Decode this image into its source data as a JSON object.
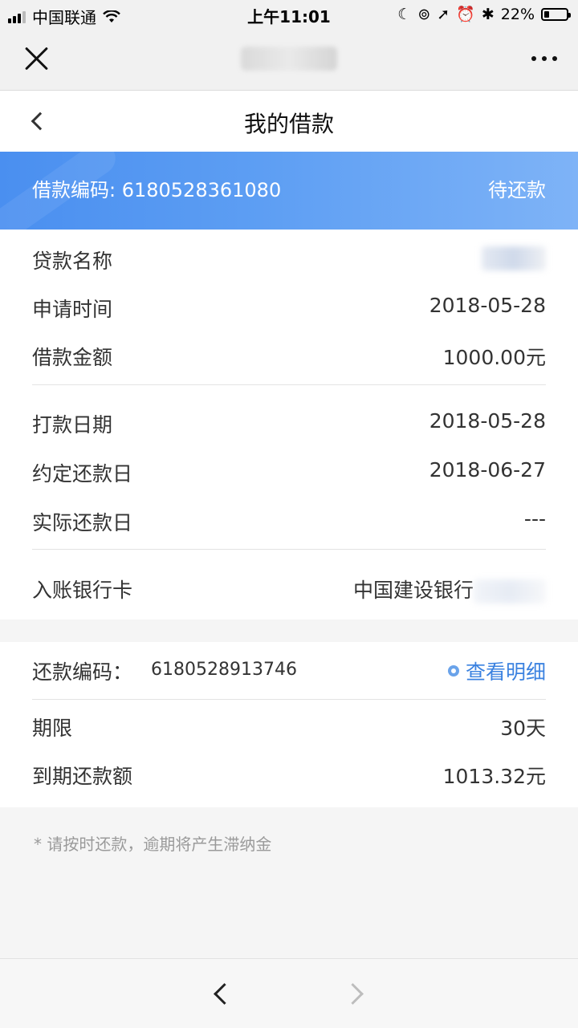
{
  "status_bar": {
    "carrier": "中国联通",
    "time": "上午11:01",
    "battery": "22%",
    "battery_level_fraction": 0.22
  },
  "browser": {
    "close_icon": "close-icon",
    "more_icon": "more-icon"
  },
  "header": {
    "title": "我的借款"
  },
  "banner": {
    "loan_code": "借款编码: 6180528361080",
    "status": "待还款"
  },
  "loan_details": {
    "loan_name_label": "贷款名称",
    "apply_time_label": "申请时间",
    "apply_time": "2018-05-28",
    "loan_amount_label": "借款金额",
    "loan_amount": "1000.00元",
    "payout_date_label": "打款日期",
    "payout_date": "2018-05-28",
    "due_date_label": "约定还款日",
    "due_date": "2018-06-27",
    "actual_repay_label": "实际还款日",
    "actual_repay": "---",
    "bank_card_label": "入账银行卡",
    "bank_card": "中国建设银行"
  },
  "repayment": {
    "code_label": "还款编码：",
    "code": "6180528913746",
    "detail_link": "查看明细",
    "term_label": "期限",
    "term": "30天",
    "due_amount_label": "到期还款额",
    "due_amount": "1013.32元"
  },
  "notice": "* 请按时还款，逾期将产生滞纳金"
}
